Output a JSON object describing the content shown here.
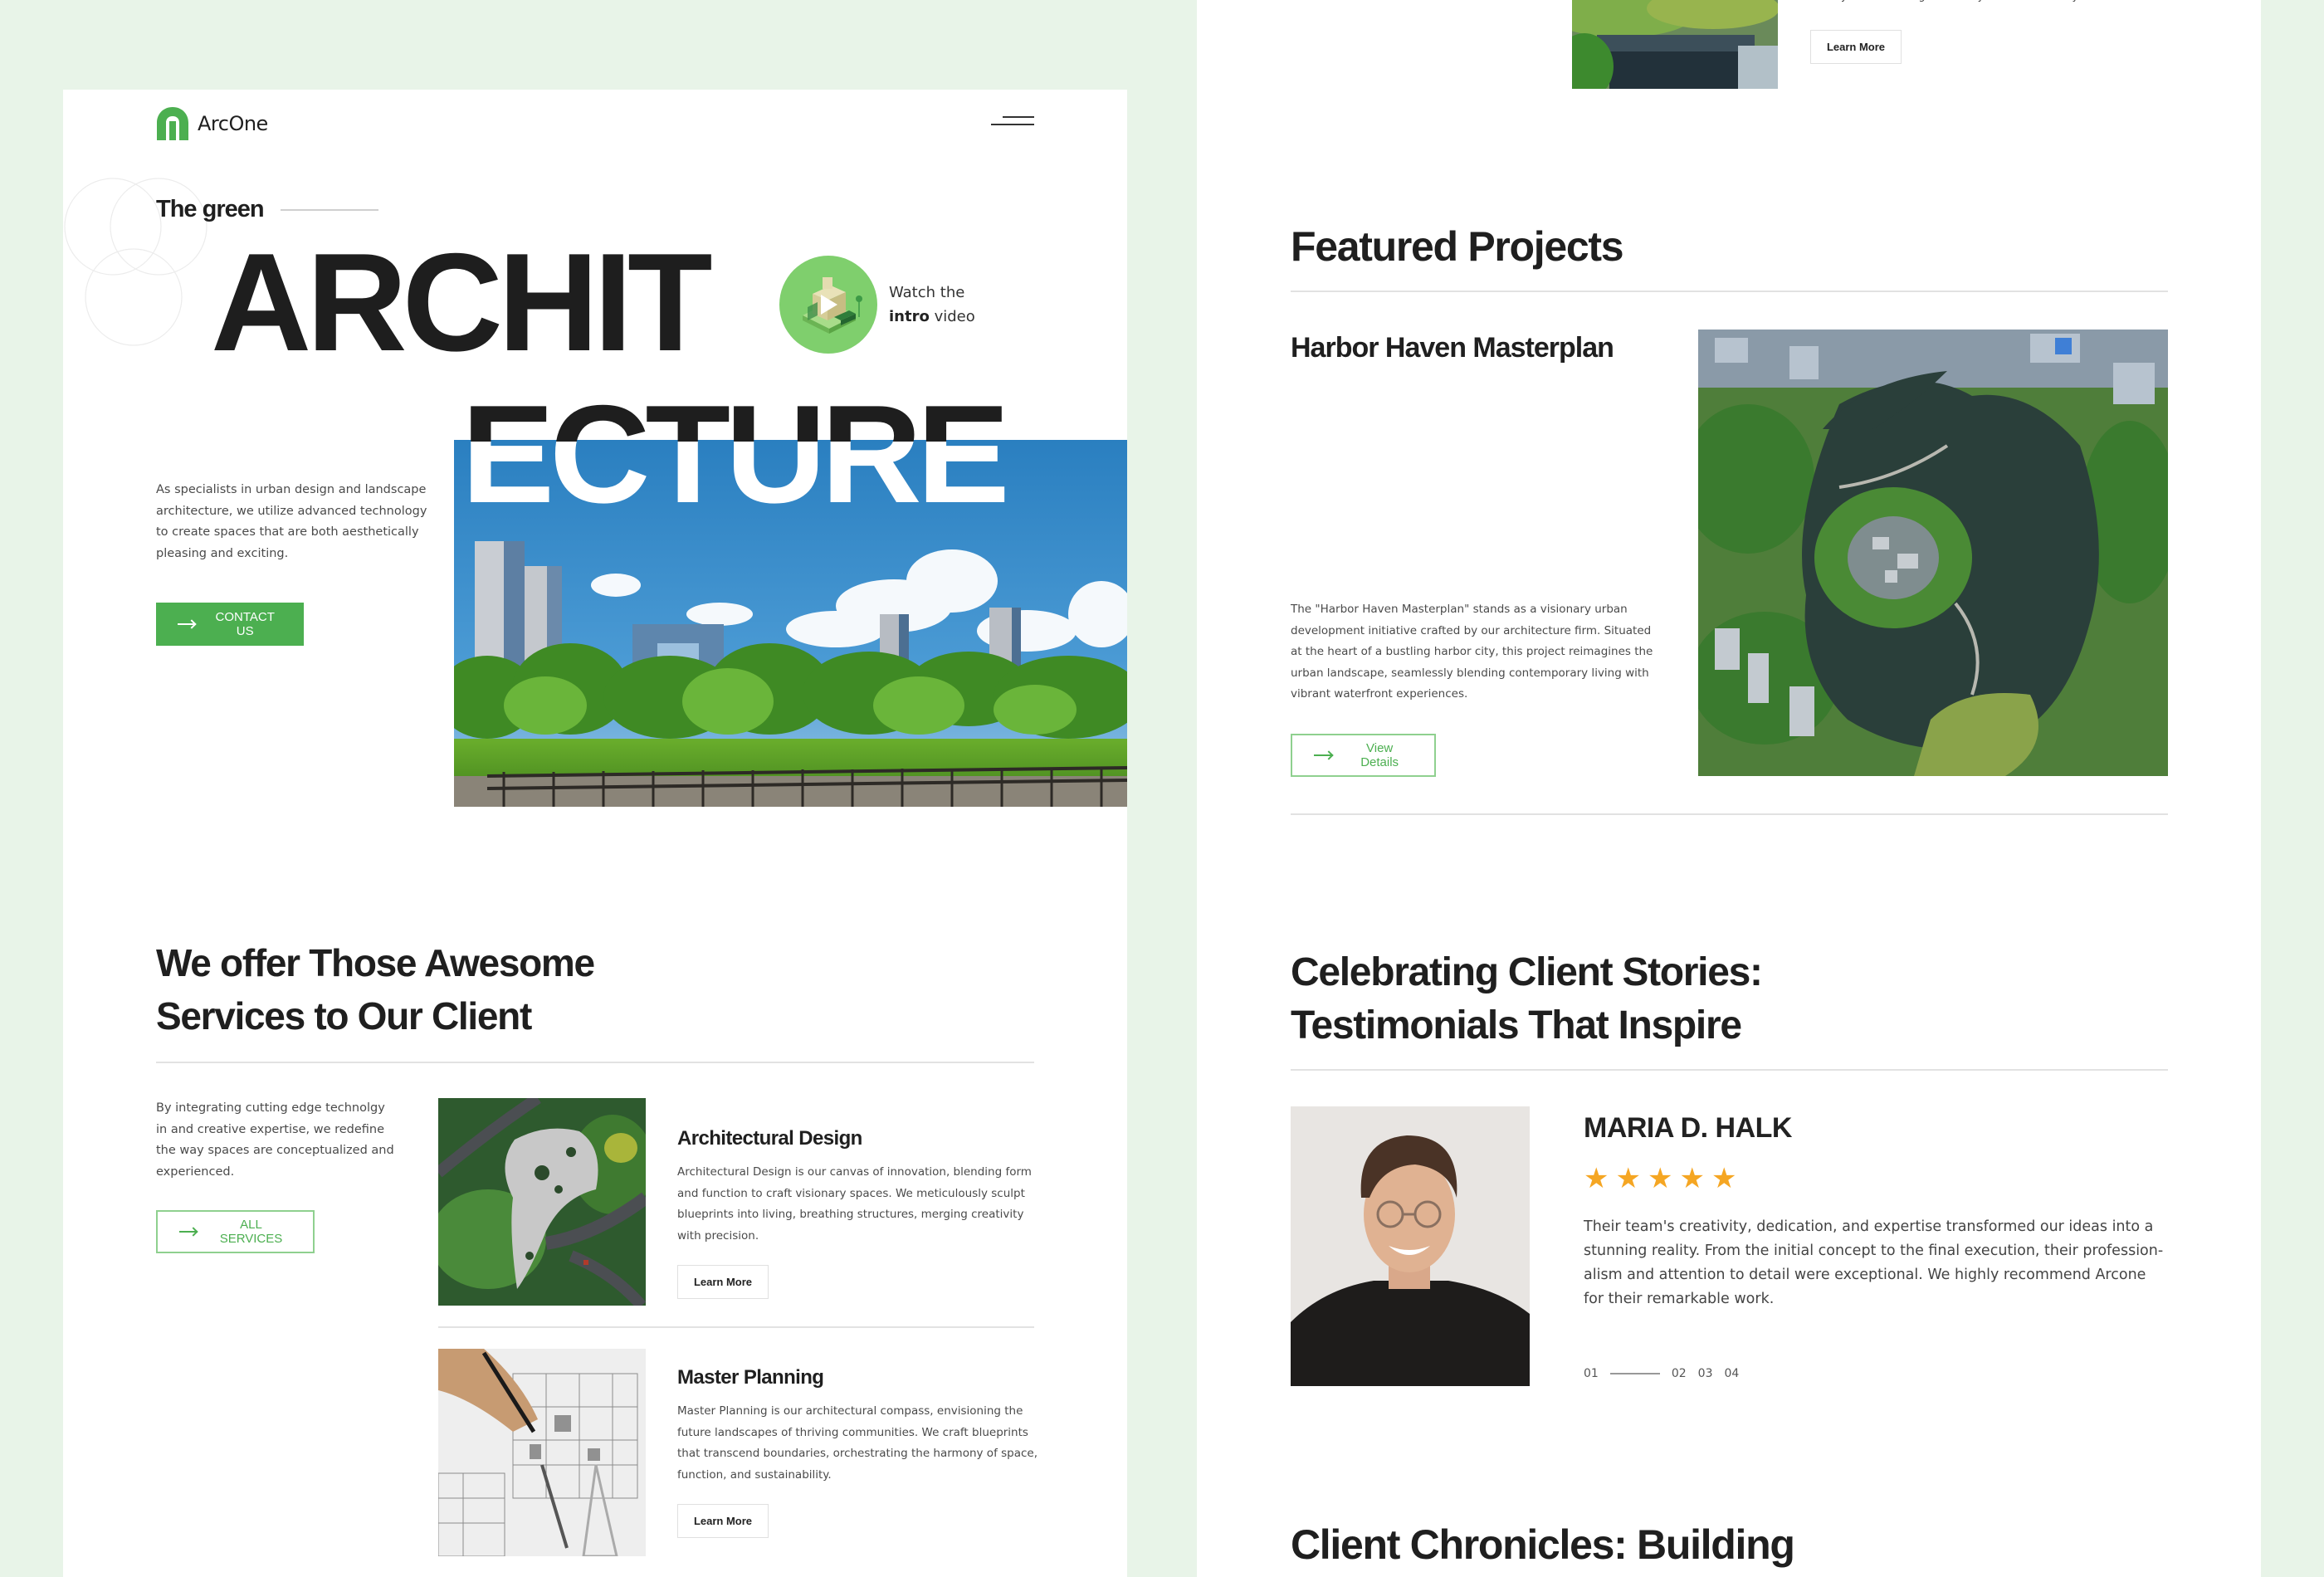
{
  "colors": {
    "page_background": "#E8F4E8",
    "accent_green": "#4CAF50",
    "star_color": "#F5A623",
    "heading": "#1F1F1F"
  },
  "brand": {
    "name": "ArcOne",
    "logo_icon": "arch-logo-icon"
  },
  "nav": {
    "menu_icon": "hamburger-menu-icon"
  },
  "hero": {
    "eyebrow": "The green",
    "title_part1": "ARCHIT",
    "title_part2": "ECTURE",
    "video_line1": "Watch the",
    "video_bold": "intro",
    "video_rest": " video",
    "video_icon": "play-icon",
    "description": "As specialists in urban design and landscape architecture, we utilize advanced technology to create spaces that are both aesthetically pleasing and exciting.",
    "cta_label": "CONTACT US",
    "cta_icon": "arrow-right-icon",
    "image_alt": "City skyline behind green park"
  },
  "services": {
    "heading_line1": "We offer Those Awesome",
    "heading_line2": "Services to Our Client",
    "intro": "By integrating cutting edge technolgy in and creative expertise, we redefine the way spaces are conceptualized and experienced.",
    "all_services_label": "ALL SERVICES",
    "items": [
      {
        "title": "Architectural Design",
        "description": "Architectural Design is our canvas of innovation, blending form and function to craft visionary spaces. We meticulously sculpt blueprints into living, breathing structures, merging creativity with precision.",
        "button_label": "Learn More",
        "image_alt": "Aerial view of park plaza"
      },
      {
        "title": "Master Planning",
        "description": "Master Planning is our architectural compass, envisioning the future landscapes of thriving communities. We craft blueprints that transcend boundaries, orchestrating the harmony of space, function, and sustainability.",
        "button_label": "Learn More",
        "image_alt": "Hand drawing blueprints"
      }
    ]
  },
  "right_page": {
    "prev_item": {
      "text_tail": "history while infusing modernity and functionality.",
      "button_label": "Learn More",
      "image_alt": "Green rooftop building"
    },
    "featured": {
      "heading": "Featured Projects",
      "project_title": "Harbor Haven Masterplan",
      "project_description": "The \"Harbor Haven Masterplan\" stands as a visionary urban development initiative crafted by our architecture firm. Situated at the heart of a bustling harbor city, this project reimagines the urban landscape, seamlessly blending contemporary living with vibrant waterfront experiences.",
      "button_label": "View Details",
      "image_alt": "Aerial view of harbor lake and island"
    },
    "testimonials": {
      "heading_line1": "Celebrating Client Stories:",
      "heading_line2": "Testimonials That Inspire",
      "name": "MARIA D. HALK",
      "rating": 5,
      "rating_max": 5,
      "quote": "Their team's creativity, dedication, and expertise transformed our ideas into a stunning reality. From the initial concept to the final execution, their profession-alism and attention to detail were exceptional. We highly recommend Arcone for their remarkable work.",
      "pager": [
        "01",
        "02",
        "03",
        "04"
      ],
      "active_page": "01"
    },
    "chronicles": {
      "heading": "Client Chronicles: Building"
    }
  }
}
